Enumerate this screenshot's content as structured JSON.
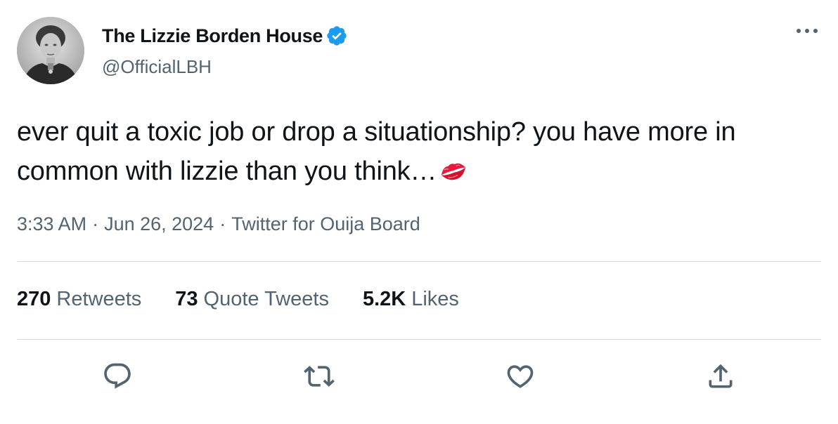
{
  "author": {
    "display_name": "The Lizzie Borden House",
    "handle": "@OfficialLBH",
    "verified": true,
    "avatar_icon": "portrait-photo"
  },
  "tweet": {
    "text": "ever quit a toxic job or drop a situationship? you have more in common with lizzie than you think…",
    "emoji_icon": "kiss-mark-icon"
  },
  "meta": {
    "time": "3:33 AM",
    "separator": "·",
    "date": "Jun 26, 2024",
    "source": "Twitter for Ouija Board"
  },
  "stats": {
    "retweets_count": "270",
    "retweets_label": "Retweets",
    "quotes_count": "73",
    "quotes_label": "Quote Tweets",
    "likes_count": "5.2K",
    "likes_label": "Likes"
  },
  "actions": [
    "reply-icon",
    "retweet-icon",
    "like-icon",
    "share-icon"
  ],
  "colors": {
    "text": "#0f1419",
    "secondary": "#536471",
    "verified": "#1d9bf0",
    "divider": "#cfd9de",
    "kiss": "#e8193c"
  }
}
